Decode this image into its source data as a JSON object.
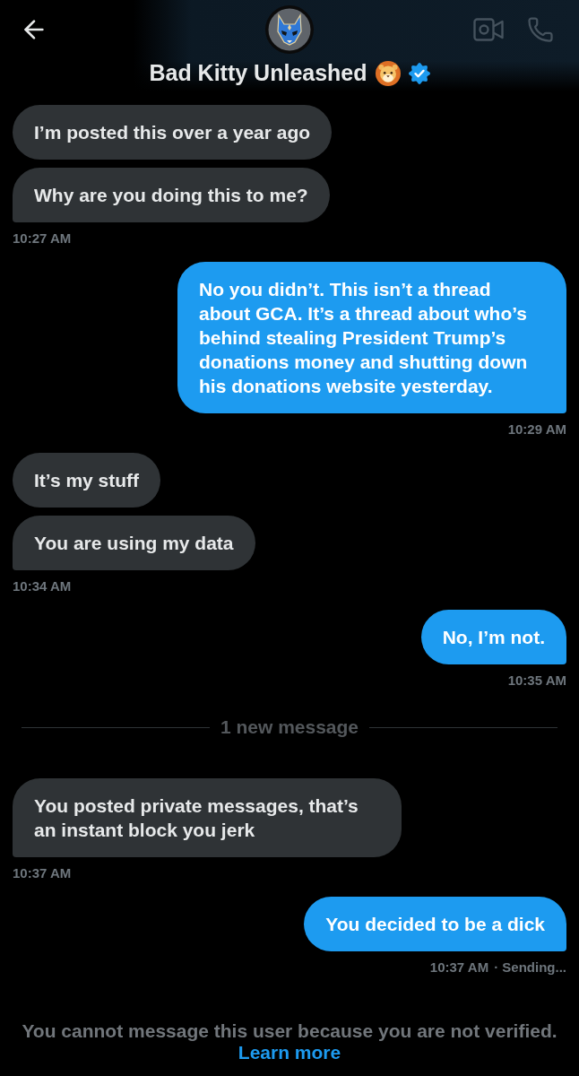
{
  "header": {
    "title": "Bad Kitty Unleashed",
    "verified": true
  },
  "thread": [
    {
      "kind": "received",
      "messages": [
        "I’m posted this over a year ago",
        "Why are you doing this to me?"
      ],
      "time": "10:27 AM"
    },
    {
      "kind": "sent",
      "messages": [
        "No you didn’t. This isn’t a thread about GCA. It’s a thread about who’s behind stealing President Trump’s donations money and shutting down his donations website yesterday."
      ],
      "time": "10:29 AM"
    },
    {
      "kind": "received",
      "messages": [
        "It’s my stuff",
        "You are using my data"
      ],
      "time": "10:34 AM"
    },
    {
      "kind": "sent",
      "messages": [
        "No, I’m not."
      ],
      "time": "10:35 AM"
    },
    {
      "kind": "divider",
      "label": "1 new message"
    },
    {
      "kind": "received",
      "messages": [
        "You posted private messages, that’s an instant block you jerk"
      ],
      "time": "10:37 AM"
    },
    {
      "kind": "sent",
      "messages": [
        "You decided to be a dick"
      ],
      "time": "10:37 AM",
      "status": "· Sending..."
    }
  ],
  "footer": {
    "notice": "You cannot message this user because you are not verified.",
    "link": "Learn more"
  }
}
